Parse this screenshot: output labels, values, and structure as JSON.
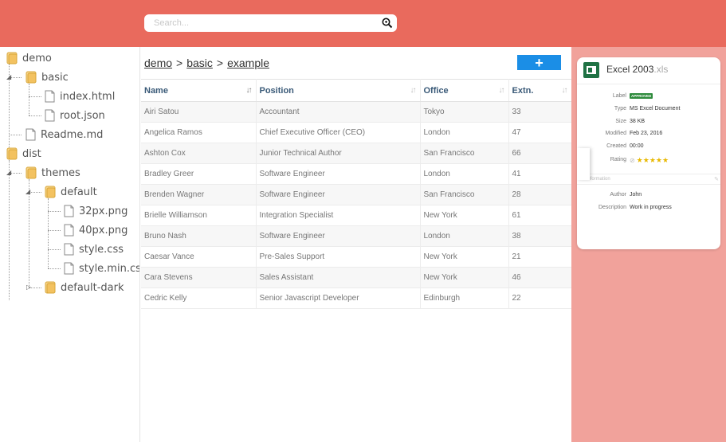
{
  "search": {
    "placeholder": "Search...",
    "icon": "search-icon"
  },
  "tree": {
    "nodes": [
      {
        "label": "demo",
        "type": "folder"
      },
      {
        "label": "basic",
        "type": "folder"
      },
      {
        "label": "index.html",
        "type": "file"
      },
      {
        "label": "root.json",
        "type": "file"
      },
      {
        "label": "Readme.md",
        "type": "file"
      },
      {
        "label": "dist",
        "type": "folder"
      },
      {
        "label": "themes",
        "type": "folder"
      },
      {
        "label": "default",
        "type": "folder"
      },
      {
        "label": "32px.png",
        "type": "file"
      },
      {
        "label": "40px.png",
        "type": "file"
      },
      {
        "label": "style.css",
        "type": "file"
      },
      {
        "label": "style.min.css",
        "type": "file"
      },
      {
        "label": "default-dark",
        "type": "folder"
      }
    ]
  },
  "breadcrumb": {
    "items": [
      "demo",
      "basic",
      "example"
    ],
    "separator": ">"
  },
  "add_button": {
    "label": "+"
  },
  "table": {
    "columns": [
      "Name",
      "Position",
      "Office",
      "Extn."
    ],
    "rows": [
      [
        "Airi Satou",
        "Accountant",
        "Tokyo",
        "33"
      ],
      [
        "Angelica Ramos",
        "Chief Executive Officer (CEO)",
        "London",
        "47"
      ],
      [
        "Ashton Cox",
        "Junior Technical Author",
        "San Francisco",
        "66"
      ],
      [
        "Bradley Greer",
        "Software Engineer",
        "London",
        "41"
      ],
      [
        "Brenden Wagner",
        "Software Engineer",
        "San Francisco",
        "28"
      ],
      [
        "Brielle Williamson",
        "Integration Specialist",
        "New York",
        "61"
      ],
      [
        "Bruno Nash",
        "Software Engineer",
        "London",
        "38"
      ],
      [
        "Caesar Vance",
        "Pre-Sales Support",
        "New York",
        "21"
      ],
      [
        "Cara Stevens",
        "Sales Assistant",
        "New York",
        "46"
      ],
      [
        "Cedric Kelly",
        "Senior Javascript Developer",
        "Edinburgh",
        "22"
      ]
    ]
  },
  "details": {
    "file_name": "Excel 2003",
    "file_ext": ".xls",
    "label_key": "Label",
    "label_badge": "APPROVED",
    "type_key": "Type",
    "type_value": "MS Excel Document",
    "size_key": "Size",
    "size_value": "38 KB",
    "modified_key": "Modified",
    "modified_value": "Feb 23, 2016",
    "created_key": "Created",
    "created_value": "00:00",
    "rating_key": "Rating",
    "rating_value": 5,
    "section_label": "us information",
    "author_key": "Author",
    "author_value": "John",
    "description_key": "Description",
    "description_value": "Work in progress"
  },
  "colors": {
    "header": "#e96a5d",
    "side_panel": "#f1a29b",
    "add_button": "#1b8ee6",
    "badge": "#2e8b3c",
    "excel": "#1f7244"
  }
}
